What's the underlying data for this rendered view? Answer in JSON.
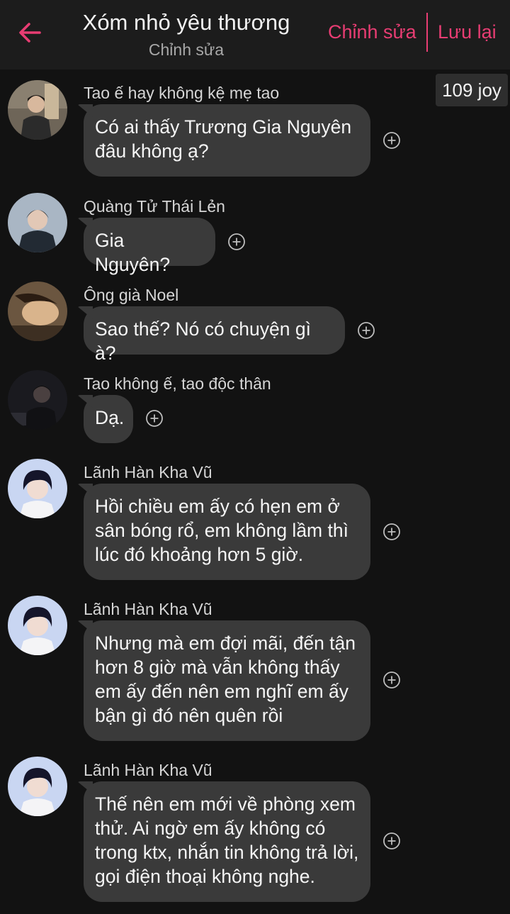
{
  "header": {
    "title": "Xóm nhỏ yêu thương",
    "subtitle": "Chỉnh sửa",
    "edit_label": "Chỉnh sửa",
    "save_label": "Lưu lại",
    "back_icon": "arrow-left-icon",
    "accent_color": "#e83d73"
  },
  "joy_badge": "109 joy",
  "messages": [
    {
      "sender": "Tao ế hay không kệ mẹ tao",
      "text": "Có ai thấy Trương Gia Nguyên đâu không ạ?"
    },
    {
      "sender": "Quàng Tử Thái Lẻn",
      "text": "Gia Nguyên?"
    },
    {
      "sender": "Ông già Noel",
      "text": "Sao thế? Nó có chuyện gì à?"
    },
    {
      "sender": "Tao không ế, tao độc thân",
      "text": "Dạ."
    },
    {
      "sender": "Lãnh Hàn Kha Vũ",
      "text": "Hồi chiều em ấy có hẹn em ở sân bóng rổ, em không lầm thì lúc đó khoảng hơn 5 giờ."
    },
    {
      "sender": "Lãnh Hàn Kha Vũ",
      "text": "Nhưng mà em đợi mãi, đến tận hơn 8 giờ mà vẫn không thấy em ấy đến nên em nghĩ em ấy bận gì đó nên quên rồi"
    },
    {
      "sender": "Lãnh Hàn Kha Vũ",
      "text": "Thế nên em mới về phòng xem thử. Ai ngờ em ấy không có trong ktx, nhắn tin không trả lời, gọi điện thoại không nghe."
    }
  ]
}
